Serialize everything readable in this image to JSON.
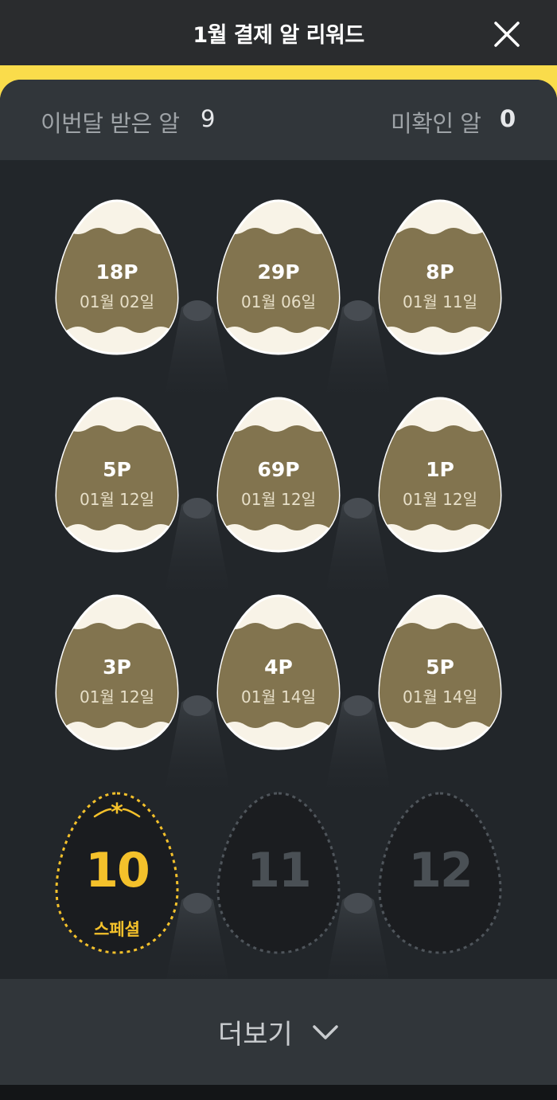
{
  "header": {
    "title": "1월 결제 알 리워드",
    "close_icon": "close-icon"
  },
  "stats": {
    "received_label": "이번달 받은 알",
    "received_value": "9",
    "unchecked_label": "미확인 알",
    "unchecked_value": "0"
  },
  "eggs": [
    {
      "points": "18P",
      "date": "01월 02일"
    },
    {
      "points": "29P",
      "date": "01월 06일"
    },
    {
      "points": "8P",
      "date": "01월 11일"
    },
    {
      "points": "5P",
      "date": "01월 12일"
    },
    {
      "points": "69P",
      "date": "01월 12일"
    },
    {
      "points": "1P",
      "date": "01월 12일"
    },
    {
      "points": "3P",
      "date": "01월 12일"
    },
    {
      "points": "4P",
      "date": "01월 14일"
    },
    {
      "points": "5P",
      "date": "01월 14일"
    }
  ],
  "upcoming": [
    {
      "number": "10",
      "badge": "스페셜",
      "highlight": true
    },
    {
      "number": "11",
      "highlight": false
    },
    {
      "number": "12",
      "highlight": false
    }
  ],
  "footer": {
    "more_label": "더보기",
    "icon": "chevron-down-icon"
  },
  "colors": {
    "accent_yellow": "#fadc4b",
    "special_gold": "#f4c12b",
    "egg_shell": "#f8f3e7",
    "egg_band": "#82744f",
    "background": "#22262a",
    "header": "#2a2c2e"
  }
}
